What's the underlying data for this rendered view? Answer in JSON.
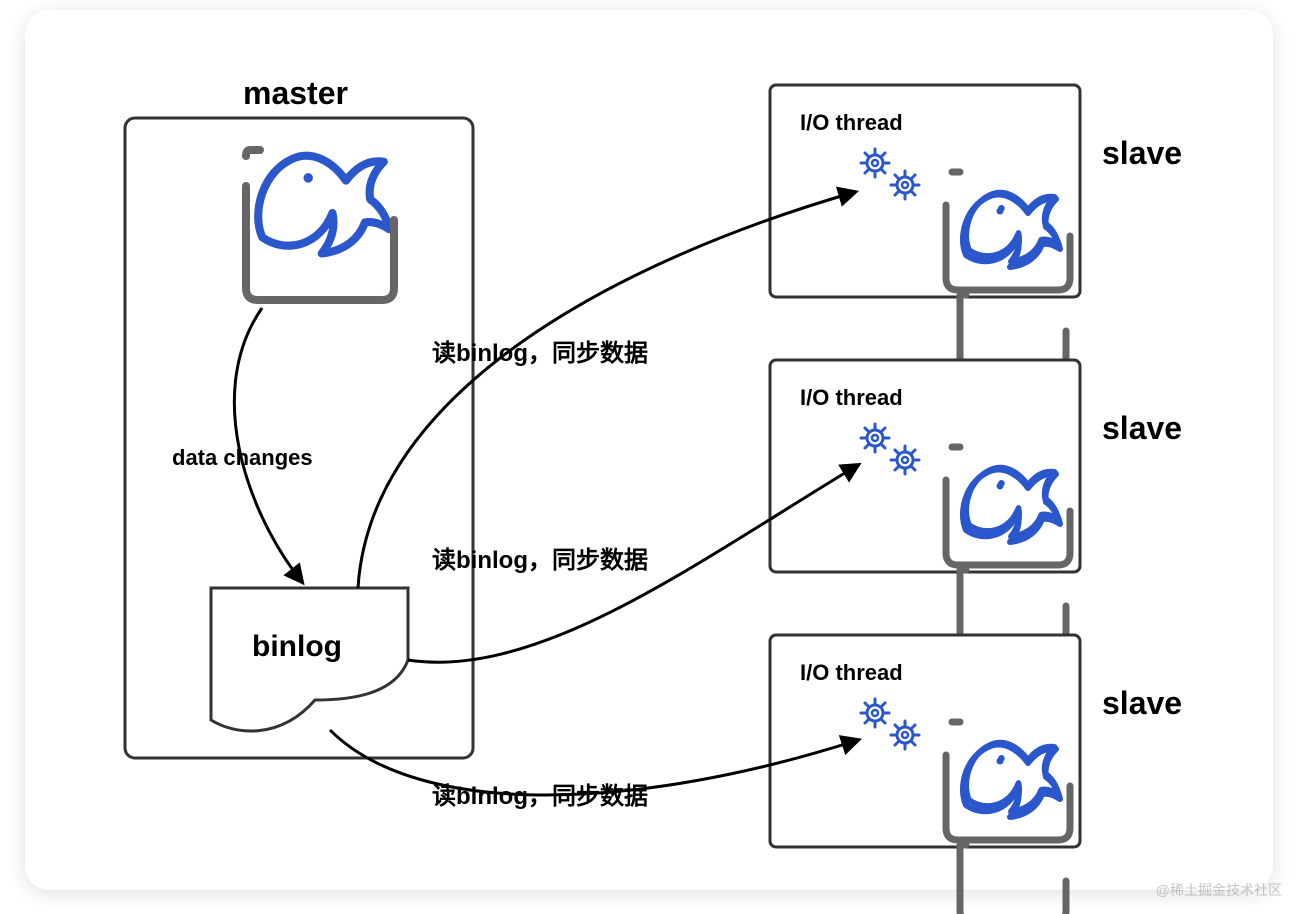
{
  "master": {
    "title": "master",
    "data_changes_label": "data changes",
    "binlog_label": "binlog"
  },
  "arrows": {
    "label_1": "读binlog，同步数据",
    "label_2": "读binlog，同步数据",
    "label_3": "读binlog，同步数据"
  },
  "slaves": [
    {
      "title": "slave",
      "io_label": "I/O thread"
    },
    {
      "title": "slave",
      "io_label": "I/O thread"
    },
    {
      "title": "slave",
      "io_label": "I/O thread"
    }
  ],
  "watermark": "@稀土掘金技术社区",
  "colors": {
    "stroke": "#333333",
    "blue": "#2a57cc",
    "gray": "#666666"
  }
}
